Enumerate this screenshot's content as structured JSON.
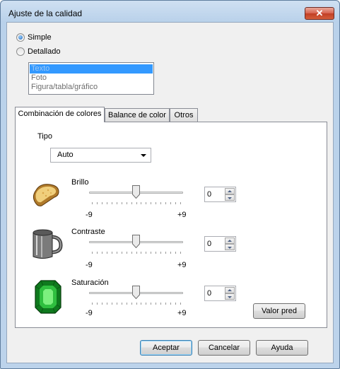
{
  "window": {
    "title": "Ajuste de la calidad",
    "close_glyph": "✕"
  },
  "mode": {
    "options": [
      {
        "label": "Simple",
        "checked": true
      },
      {
        "label": "Detallado",
        "checked": false
      }
    ]
  },
  "doc_type_list": {
    "items": [
      "Texto",
      "Foto",
      "Figura/tabla/gráfico"
    ],
    "selected_index": 0
  },
  "tabs": [
    {
      "label": "Combinación de colores",
      "active": true
    },
    {
      "label": "Balance de color",
      "active": false
    },
    {
      "label": "Otros",
      "active": false
    }
  ],
  "tipo": {
    "label": "Tipo",
    "value": "Auto"
  },
  "sliders": [
    {
      "label": "Brillo",
      "value": "0",
      "min_label": "-9",
      "max_label": "+9",
      "icon": "bread-icon",
      "level": 0
    },
    {
      "label": "Contraste",
      "value": "0",
      "min_label": "-9",
      "max_label": "+9",
      "icon": "mug-icon",
      "level": 0
    },
    {
      "label": "Saturación",
      "value": "0",
      "min_label": "-9",
      "max_label": "+9",
      "icon": "emerald-icon",
      "level": 0
    }
  ],
  "default_button": "Valor pred",
  "footer": {
    "accept": "Aceptar",
    "cancel": "Cancelar",
    "help": "Ayuda"
  }
}
